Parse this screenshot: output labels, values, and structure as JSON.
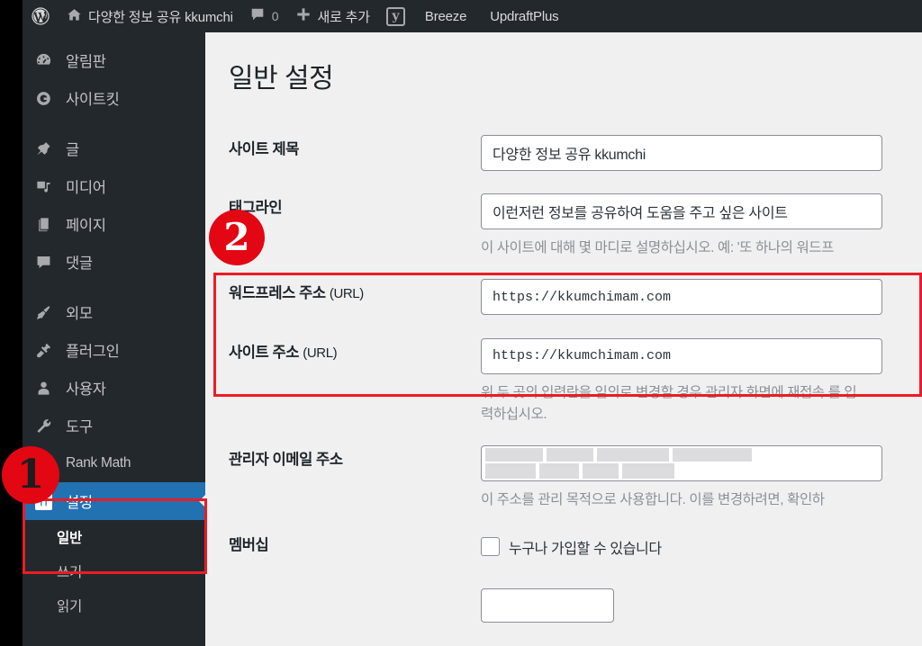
{
  "adminbar": {
    "logo_icon": "wordpress-logo-icon",
    "home_icon": "home-icon",
    "site_name": "다양한 정보 공유 kkumchi",
    "comments_icon": "comment-bubble-icon",
    "comments_count": "0",
    "new_icon": "plus-icon",
    "new_label": "새로 추가",
    "yoast_icon": "yoast-seo-icon",
    "yoast_glyph": "y",
    "items": [
      {
        "label": "Breeze"
      },
      {
        "label": "UpdraftPlus"
      }
    ]
  },
  "sidebar": {
    "items": [
      {
        "label": "알림판",
        "icon": "dashboard-icon",
        "gap_before": false
      },
      {
        "label": "사이트킷",
        "icon": "google-site-kit-icon",
        "gap_before": false
      },
      {
        "label": "글",
        "icon": "pin-icon",
        "gap_before": true
      },
      {
        "label": "미디어",
        "icon": "media-icon",
        "gap_before": false
      },
      {
        "label": "페이지",
        "icon": "pages-icon",
        "gap_before": false
      },
      {
        "label": "댓글",
        "icon": "comment-icon",
        "gap_before": false
      },
      {
        "label": "외모",
        "icon": "appearance-brush-icon",
        "gap_before": true
      },
      {
        "label": "플러그인",
        "icon": "plugin-icon",
        "gap_before": false
      },
      {
        "label": "사용자",
        "icon": "user-icon",
        "gap_before": false
      },
      {
        "label": "도구",
        "icon": "tools-wrench-icon",
        "gap_before": false
      },
      {
        "label": "Rank Math",
        "icon": "rank-math-icon",
        "gap_before": false
      }
    ],
    "settings": {
      "label": "설정",
      "icon": "settings-sliders-icon",
      "current": true
    },
    "submenu": [
      {
        "label": "일반",
        "active": true
      },
      {
        "label": "쓰기",
        "active": false
      },
      {
        "label": "읽기",
        "active": false
      }
    ]
  },
  "main": {
    "page_title": "일반 설정",
    "fields": {
      "site_title": {
        "label": "사이트 제목",
        "value": "다양한 정보 공유 kkumchi"
      },
      "tagline": {
        "label": "태그라인",
        "value": "이런저런 정보를 공유하여 도움을 주고 싶은 사이트",
        "description": "이 사이트에 대해 몇 마디로 설명하십시오. 예: '또 하나의 워드프"
      },
      "wp_address": {
        "label": "워드프레스 주소",
        "label_suffix": "(URL)",
        "value": "https://kkumchimam.com"
      },
      "site_address": {
        "label": "사이트 주소",
        "label_suffix": "(URL)",
        "value": "https://kkumchimam.com",
        "description": "위 두 곳의 입력란을 임의로 변경할 경우 관리자 화면에 재접속 를 입력하십시오."
      },
      "admin_email": {
        "label": "관리자 이메일 주소",
        "value": "",
        "redacted": true,
        "description": "이 주소를 관리 목적으로 사용합니다. 이를 변경하려면, 확인하"
      },
      "membership": {
        "label": "멤버십",
        "checkbox_label": "누구나 가입할 수 있습니다",
        "checked": false
      }
    }
  },
  "annotations": {
    "badges": [
      {
        "id": "1",
        "text": "1"
      },
      {
        "id": "2",
        "text": "2"
      }
    ],
    "highlight_color": "#ec1c24",
    "badge_color": "#e30613"
  }
}
